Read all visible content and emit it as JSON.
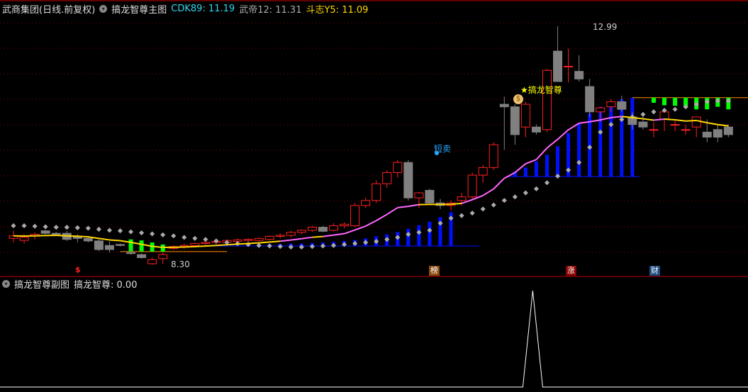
{
  "header": {
    "title": "武商集团(日线.前复权)",
    "main_indicator": "搞龙智尊主图",
    "cdk_label": "CDK89: ",
    "cdk_value": "11.19",
    "wd_label": "武帝12: ",
    "wd_value": "11.31",
    "dz_label": "斗志Y5: ",
    "dz_value": "11.09"
  },
  "sub": {
    "title": "搞龙智尊副图",
    "value_label": "搞龙智尊: ",
    "value": "0.00"
  },
  "annotations": {
    "high": "12.99",
    "low": "8.30",
    "sell": "短卖",
    "signal": "★搞龙智尊"
  },
  "markers": [
    {
      "text": "$",
      "color": "#ff2020"
    },
    {
      "text": "榜",
      "color": "#8b4a10"
    },
    {
      "text": "涨",
      "color": "#8b0000"
    },
    {
      "text": "财",
      "color": "#1c4a80"
    }
  ],
  "colors": {
    "up": "#ff2020",
    "down": "#808080",
    "ma_rise": "#ff66ff",
    "ma_flat": "#ffd700",
    "bar": "#0010ff",
    "green": "#00ff00",
    "grid": "#8b0000"
  },
  "chart_data": {
    "type": "candlestick",
    "ylim": [
      8.3,
      12.99
    ],
    "candles": [
      [
        8.8,
        8.95,
        8.72,
        8.85
      ],
      [
        8.76,
        8.88,
        8.7,
        8.82
      ],
      [
        8.85,
        8.92,
        8.78,
        8.88
      ],
      [
        8.95,
        8.97,
        8.88,
        8.9
      ],
      [
        8.9,
        8.93,
        8.85,
        8.88
      ],
      [
        8.9,
        8.95,
        8.75,
        8.78
      ],
      [
        8.84,
        8.88,
        8.72,
        8.8
      ],
      [
        8.8,
        8.85,
        8.72,
        8.75
      ],
      [
        8.75,
        8.78,
        8.55,
        8.58
      ],
      [
        8.66,
        8.74,
        8.52,
        8.58
      ],
      [
        8.68,
        8.7,
        8.64,
        8.66
      ],
      [
        8.52,
        8.6,
        8.48,
        8.5
      ],
      [
        8.48,
        8.5,
        8.4,
        8.42
      ],
      [
        8.3,
        8.42,
        8.28,
        8.38
      ],
      [
        8.4,
        8.52,
        8.3,
        8.48
      ],
      [
        8.6,
        8.66,
        8.58,
        8.64
      ],
      [
        8.64,
        8.7,
        8.6,
        8.66
      ],
      [
        8.66,
        8.72,
        8.62,
        8.7
      ],
      [
        8.7,
        8.74,
        8.66,
        8.72
      ],
      [
        8.72,
        8.76,
        8.68,
        8.74
      ],
      [
        8.72,
        8.78,
        8.7,
        8.76
      ],
      [
        8.74,
        8.8,
        8.7,
        8.77
      ],
      [
        8.76,
        8.8,
        8.72,
        8.78
      ],
      [
        8.76,
        8.82,
        8.74,
        8.8
      ],
      [
        8.78,
        8.86,
        8.76,
        8.84
      ],
      [
        8.84,
        8.9,
        8.8,
        8.86
      ],
      [
        8.86,
        8.95,
        8.82,
        8.92
      ],
      [
        8.92,
        8.98,
        8.88,
        8.96
      ],
      [
        8.96,
        9.05,
        8.93,
        9.02
      ],
      [
        9.02,
        9.05,
        8.92,
        8.94
      ],
      [
        8.96,
        9.1,
        8.94,
        9.05
      ],
      [
        9.05,
        9.12,
        9.0,
        9.08
      ],
      [
        9.05,
        9.5,
        9.02,
        9.45
      ],
      [
        9.45,
        9.6,
        9.4,
        9.55
      ],
      [
        9.55,
        9.95,
        9.5,
        9.88
      ],
      [
        9.88,
        10.15,
        9.8,
        10.1
      ],
      [
        10.1,
        10.35,
        10.0,
        10.3
      ],
      [
        10.3,
        10.35,
        9.55,
        9.6
      ],
      [
        9.6,
        9.72,
        9.4,
        9.7
      ],
      [
        9.75,
        9.78,
        9.48,
        9.5
      ],
      [
        9.5,
        9.58,
        9.38,
        9.45
      ],
      [
        9.45,
        9.55,
        9.35,
        9.5
      ],
      [
        9.55,
        9.7,
        9.45,
        9.62
      ],
      [
        9.62,
        10.1,
        9.58,
        10.05
      ],
      [
        10.05,
        10.25,
        9.9,
        10.2
      ],
      [
        10.2,
        10.7,
        10.15,
        10.65
      ],
      [
        11.45,
        11.6,
        10.55,
        11.4
      ],
      [
        11.4,
        11.45,
        10.65,
        10.85
      ],
      [
        11.0,
        11.5,
        10.8,
        11.45
      ],
      [
        11.0,
        11.05,
        10.85,
        10.9
      ],
      [
        10.95,
        12.15,
        10.9,
        12.12
      ],
      [
        12.5,
        12.99,
        11.9,
        11.9
      ],
      [
        12.2,
        12.55,
        11.88,
        12.2
      ],
      [
        12.1,
        12.42,
        11.9,
        11.95
      ],
      [
        11.8,
        11.95,
        11.2,
        11.3
      ],
      [
        11.3,
        11.4,
        11.1,
        11.38
      ],
      [
        11.4,
        11.55,
        11.3,
        11.5
      ],
      [
        11.5,
        11.62,
        11.3,
        11.35
      ],
      [
        11.2,
        11.3,
        10.95,
        11.05
      ],
      [
        11.1,
        11.25,
        10.95,
        11.0
      ],
      [
        10.95,
        11.1,
        10.8,
        10.95
      ],
      [
        11.15,
        11.3,
        10.92,
        11.3
      ],
      [
        11.05,
        11.15,
        10.92,
        11.05
      ],
      [
        10.95,
        11.05,
        10.85,
        10.95
      ],
      [
        11.0,
        11.2,
        10.8,
        11.2
      ],
      [
        10.9,
        11.15,
        10.7,
        10.8
      ],
      [
        10.95,
        11.05,
        10.7,
        10.8
      ],
      [
        11.0,
        11.05,
        10.8,
        10.85
      ]
    ],
    "blue_bars_1": {
      "base": 8.65,
      "start": 19,
      "tops": [
        8.66,
        8.67,
        8.67,
        8.68,
        8.68,
        8.69,
        8.69,
        8.7,
        8.7,
        8.71,
        8.72,
        8.73,
        8.75,
        8.77,
        8.8,
        8.84,
        8.88,
        8.93,
        8.99,
        9.06,
        9.13,
        9.22,
        9.32
      ]
    },
    "blue_bars_2": {
      "base": 10.02,
      "start": 47,
      "tops": [
        10.12,
        10.2,
        10.32,
        10.45,
        10.62,
        10.88,
        11.08,
        11.27,
        11.4,
        11.5,
        11.55,
        11.58
      ]
    },
    "green_bars_1": {
      "base": 8.54,
      "start": 11,
      "tops": [
        8.78,
        8.76,
        8.72,
        8.68
      ]
    },
    "green_bars_2": {
      "base": 11.58,
      "start": 60,
      "bottoms": [
        11.48,
        11.43,
        11.42,
        11.38,
        11.35,
        11.35,
        11.4,
        11.35
      ]
    },
    "sar": [
      9.05,
      9.05,
      9.04,
      9.03,
      9.02,
      9.02,
      9.01,
      9.0,
      8.98,
      8.96,
      8.95,
      8.93,
      8.91,
      8.89,
      8.87,
      8.85,
      8.82,
      8.8,
      8.78,
      8.75,
      8.72,
      8.7,
      8.68,
      8.66,
      8.65,
      8.64,
      8.63,
      8.63,
      8.64,
      8.65,
      8.66,
      8.68,
      8.7,
      8.72,
      8.74,
      8.78,
      8.82,
      8.88,
      8.92,
      8.96,
      9.1,
      9.2,
      9.25,
      9.3,
      9.38,
      9.46,
      9.55,
      9.62,
      9.7,
      9.78,
      9.9,
      10.03,
      10.15,
      10.3,
      10.6,
      10.9,
      11.05,
      11.15,
      11.2,
      11.25,
      11.3,
      11.33,
      11.35,
      11.4,
      11.45,
      11.5,
      11.52,
      11.52
    ],
    "sub_series": {
      "spike_index": 48,
      "ylim": [
        0,
        1
      ]
    }
  }
}
